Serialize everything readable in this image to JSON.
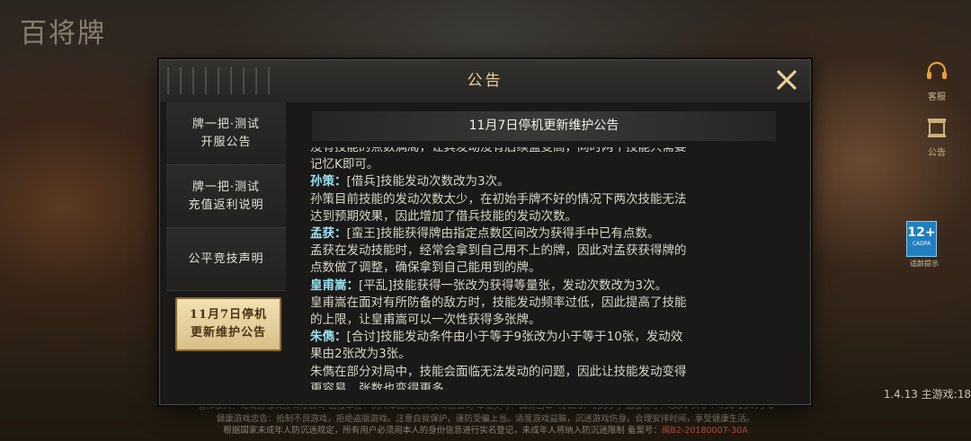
{
  "app": {
    "logo_text": "百将牌"
  },
  "side": {
    "service_label": "客服",
    "notice_label": "公告",
    "age_rating": "12+",
    "age_small": "CADPA",
    "age_caption": "适龄提示"
  },
  "version": "1.4.13 主游戏:18",
  "footer": {
    "line1": "著作权人：海南游缘科技有限公司 出版单位：杭州淳云网络科技有限公司 审批文号：国新出审〔2025〕1553号 出版物号：ISBN 978-7-498-15473-6",
    "line2": "健康游戏忠告：抵制不良游戏，拒绝盗版游戏。注意自我保护，谨防受骗上当。适度游戏益脑，沉迷游戏伤身。合理安排时间，享受健康生活。",
    "line3": "根据国家未成年人防沉迷规定，所有用户必须用本人的身份信息进行实名登记，未成年人将纳入防沉迷限制 备案号：",
    "line3_link": "闽B2-20180007-30A"
  },
  "dialog": {
    "title": "公告",
    "tabs": [
      {
        "line1": "牌一把·测试",
        "line2": "开服公告"
      },
      {
        "line1": "牌一把·测试",
        "line2": "充值返利说明"
      },
      {
        "line1": "公平竞技声明",
        "line2": ""
      },
      {
        "line1": "11月7日停机",
        "line2": "更新维护公告"
      }
    ],
    "notice_title": "11月7日停机更新维护公告",
    "body": [
      {
        "text": "没有技能的点数满局，让其发动没有后续蓝变高，同时两个技能只需要"
      },
      {
        "text": "记忆K即可。"
      },
      {
        "name": "孙策：",
        "text": "[借兵]技能发动次数改为3次。"
      },
      {
        "text": "孙策目前技能的发动次数太少，在初始手牌不好的情况下两次技能无法"
      },
      {
        "text": "达到预期效果，因此增加了借兵技能的发动次数。"
      },
      {
        "name": "孟获：",
        "text": "[蛮王]技能获得牌由指定点数区间改为获得手中已有点数。"
      },
      {
        "text": "孟获在发动技能时，经常会拿到自己用不上的牌，因此对孟获获得牌的"
      },
      {
        "text": "点数做了调整，确保拿到自己能用到的牌。"
      },
      {
        "name": "皇甫嵩：",
        "text": "[平乱]技能获得一张改为获得等量张，发动次数改为3次。"
      },
      {
        "text": "皇甫嵩在面对有所防备的敌方时，技能发动频率过低，因此提高了技能"
      },
      {
        "text": "的上限，让皇甫嵩可以一次性获得多张牌。"
      },
      {
        "name": "朱儁：",
        "text": "[合讨]技能发动条件由小于等于9张改为小于等于10张，发动效"
      },
      {
        "text": "果由2张改为3张。"
      },
      {
        "text": "朱儁在部分对局中，技能会面临无法发动的问题，因此让技能发动变得"
      },
      {
        "text": "更容易，张数也变得更多。"
      }
    ]
  },
  "colors": {
    "accent": "#e8cf95",
    "name_highlight": "#9be0f0",
    "active_tab": "#e3cd97"
  }
}
